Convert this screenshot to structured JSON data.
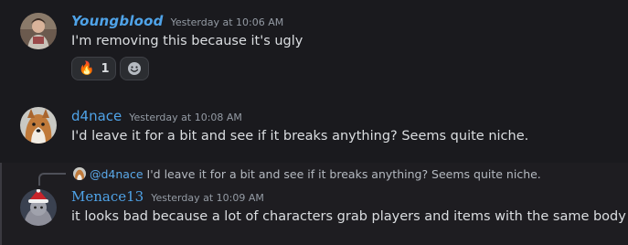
{
  "messages": [
    {
      "username": "Youngblood",
      "timestamp": "Yesterday at 10:06 AM",
      "content": "I'm removing this because it's ugly",
      "reactions": [
        {
          "emoji": "🔥",
          "count": "1"
        }
      ]
    },
    {
      "username": "d4nace",
      "timestamp": "Yesterday at 10:08 AM",
      "content": "I'd leave it for a bit and see if it breaks anything? Seems quite niche."
    },
    {
      "username": "Menace13",
      "timestamp": "Yesterday at 10:09 AM",
      "content": "it looks bad because a lot of characters grab players and items with the same body part",
      "reply": {
        "mention": "@d4nace",
        "text": "I'd leave it for a bit and see if it breaks anything? Seems quite niche."
      }
    }
  ],
  "colors": {
    "background": "#1a1a1e",
    "username": "#4fa3e8",
    "timestamp": "#949ba4",
    "text": "#dbdee1"
  }
}
